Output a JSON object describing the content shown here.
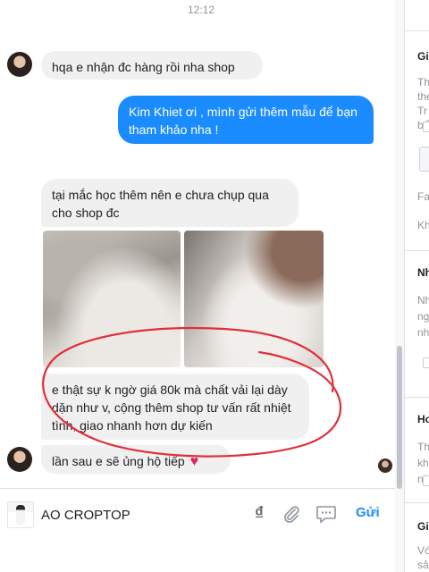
{
  "chat": {
    "timestamp": "12:12",
    "messages": [
      {
        "from": "customer",
        "text": "hqa e nhận đc hàng rồi nha shop"
      },
      {
        "from": "shop",
        "text": "Kim Khiet ơi , mình gửi thêm mẫu để bạn tham khảo nha !"
      },
      {
        "from": "customer",
        "text": "tại mắc học thêm nên e chưa chụp qua cho shop đc"
      },
      {
        "from": "customer",
        "text": "e thật sự k ngờ giá 80k mà chất vải lại dày dặn như v, cộng thêm shop tư vấn rất nhiệt tình, giao nhanh hơn dự kiến"
      },
      {
        "from": "customer",
        "text": "lần sau e sẽ ủng hộ tiếp"
      }
    ],
    "heart_emoji": "♥",
    "annotation_color": "#e0303a"
  },
  "composer": {
    "value": "AO CROPTOP",
    "currency_symbol": "₫",
    "send_label": "Gửi"
  },
  "right_panel": {
    "h1": "Gi",
    "t1": "Th",
    "t2": "the",
    "t3": "Tr",
    "t4": "bổ",
    "t5": "Fa",
    "t6": "Kh",
    "h2": "Nh",
    "t7": "Nh",
    "t8": "ng",
    "t9": "nh",
    "h3": "Ho",
    "t10": "Th",
    "t11": "kh",
    "t12": "nh",
    "h4": "Gi",
    "t13": "Vớ",
    "t14": "sả"
  },
  "colors": {
    "accent": "#1a8cff",
    "incoming_bubble": "#f1f0f0"
  }
}
